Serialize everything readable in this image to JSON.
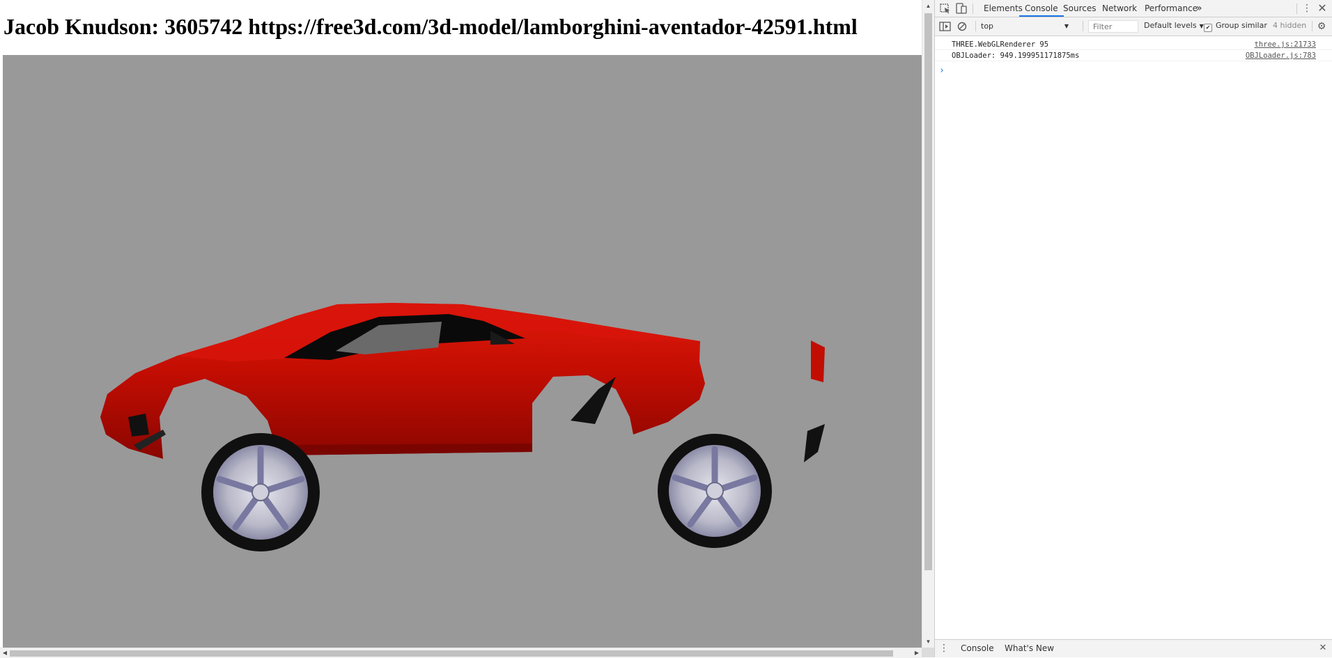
{
  "page": {
    "title": "Jacob Knudson: 3605742 https://free3d.com/3d-model/lamborghini-aventador-42591.html"
  },
  "scene": {
    "background": "#999999",
    "car_color": "#c20d02",
    "rim_color": "#b8b8c8"
  },
  "devtools": {
    "tabs": [
      {
        "label": "Elements"
      },
      {
        "label": "Console"
      },
      {
        "label": "Sources"
      },
      {
        "label": "Network"
      },
      {
        "label": "Performance"
      }
    ],
    "active_tab": "Console",
    "more_tabs_icon": "»",
    "toolbar": {
      "context": "top",
      "filter_placeholder": "Filter",
      "levels": "Default levels",
      "group_similar": "Group similar",
      "group_similar_checked": true,
      "hidden": "4 hidden"
    },
    "messages": [
      {
        "text": "THREE.WebGLRenderer 95",
        "source": "three.js:21733"
      },
      {
        "text": "OBJLoader: 949.199951171875ms",
        "source": "OBJLoader.js:783"
      }
    ],
    "prompt": "›",
    "drawer_tabs": [
      {
        "label": "Console"
      },
      {
        "label": "What's New"
      }
    ]
  }
}
